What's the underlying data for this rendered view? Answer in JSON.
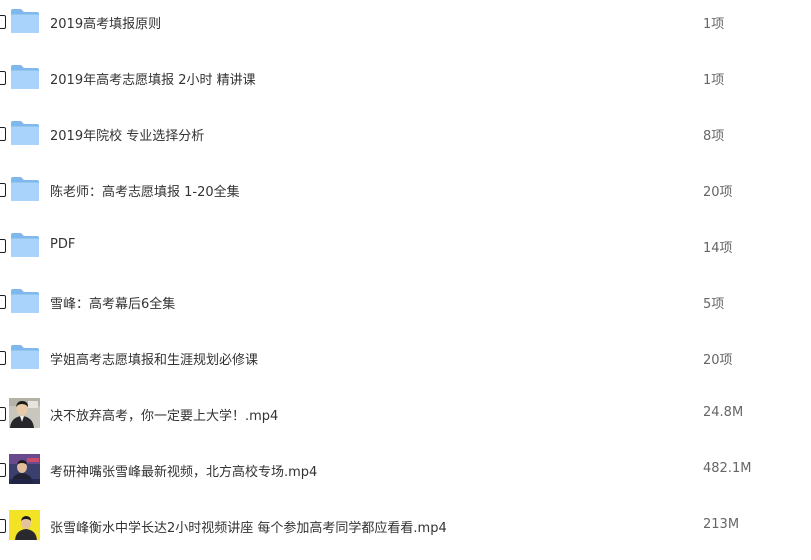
{
  "file_list": {
    "items": [
      {
        "name": "2019高考填报原则",
        "size": "1项",
        "type": "folder",
        "icon": "folder-icon"
      },
      {
        "name": "2019年高考志愿填报 2小时 精讲课",
        "size": "1项",
        "type": "folder",
        "icon": "folder-icon"
      },
      {
        "name": "2019年院校 专业选择分析",
        "size": "8项",
        "type": "folder",
        "icon": "folder-icon"
      },
      {
        "name": "陈老师：高考志愿填报 1-20全集",
        "size": "20项",
        "type": "folder",
        "icon": "folder-icon"
      },
      {
        "name": "PDF",
        "size": "14项",
        "type": "folder",
        "icon": "folder-icon"
      },
      {
        "name": "雪峰：高考幕后6全集",
        "size": "5项",
        "type": "folder",
        "icon": "folder-icon"
      },
      {
        "name": "学姐高考志愿填报和生涯规划必修课",
        "size": "20项",
        "type": "folder",
        "icon": "folder-icon"
      },
      {
        "name": "决不放弃高考，你一定要上大学！.mp4",
        "size": "24.8M",
        "type": "video",
        "icon": "video-thumbnail"
      },
      {
        "name": "考研神嘴张雪峰最新视频，北方高校专场.mp4",
        "size": "482.1M",
        "type": "video",
        "icon": "video-thumbnail"
      },
      {
        "name": "张雪峰衡水中学长达2小时视频讲座 每个参加高考同学都应看看.mp4",
        "size": "213M",
        "type": "video",
        "icon": "video-thumbnail"
      }
    ]
  },
  "colors": {
    "folder_back": "#7fb8ec",
    "folder_front": "#a9d3fb",
    "text": "#333333",
    "size_text": "#666666"
  }
}
